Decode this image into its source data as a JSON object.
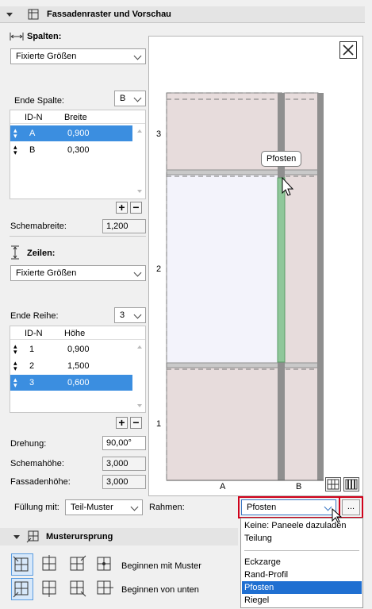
{
  "header": {
    "title": "Fassadenraster und Vorschau"
  },
  "columns": {
    "section_label": "Spalten:",
    "mode": "Fixierte Größen",
    "end_label": "Ende Spalte:",
    "end_value": "B",
    "table": {
      "col_id": "ID-N",
      "col_value": "Breite",
      "rows": [
        {
          "id": "A",
          "value": "0,900",
          "selected": true
        },
        {
          "id": "B",
          "value": "0,300",
          "selected": false
        }
      ]
    },
    "schema_label": "Schemabreite:",
    "schema_value": "1,200"
  },
  "rows": {
    "section_label": "Zeilen:",
    "mode": "Fixierte Größen",
    "end_label": "Ende Reihe:",
    "end_value": "3",
    "table": {
      "col_id": "ID-N",
      "col_value": "Höhe",
      "rows": [
        {
          "id": "1",
          "value": "0,900",
          "selected": false
        },
        {
          "id": "2",
          "value": "1,500",
          "selected": false
        },
        {
          "id": "3",
          "value": "0,600",
          "selected": true
        }
      ]
    }
  },
  "rotation": {
    "label": "Drehung:",
    "value": "90,00°"
  },
  "schema_height": {
    "label": "Schemahöhe:",
    "value": "3,000"
  },
  "facade_height": {
    "label": "Fassadenhöhe:",
    "value": "3,000"
  },
  "fill": {
    "label": "Füllung mit:",
    "value": "Teil-Muster"
  },
  "frame": {
    "label": "Rahmen:",
    "value": "Pfosten",
    "more_button": "...",
    "options": [
      {
        "label": "Keine: Paneele dazuladen",
        "selected": false
      },
      {
        "label": "Teilung",
        "selected": false
      },
      {
        "label": "Eckzarge",
        "selected": false
      },
      {
        "label": "Rand-Profil",
        "selected": false
      },
      {
        "label": "Pfosten",
        "selected": true
      },
      {
        "label": "Riegel",
        "selected": false
      }
    ]
  },
  "preview": {
    "row_labels": [
      "3",
      "2",
      "1"
    ],
    "col_labels": [
      "A",
      "B"
    ],
    "tooltip": "Pfosten"
  },
  "pattern_origin": {
    "title": "Musterursprung",
    "option1": "Beginnen mit Muster",
    "option2": "Beginnen von unten"
  },
  "colors": {
    "panel_fill": "#e7dcdc",
    "glass_fill": "#f3f3fb",
    "mullion": "#8f8f8f",
    "highlight_mullion": "#8fc79a",
    "selection": "#3b8ee0",
    "dropdown_highlight": "#1f6fd1",
    "red_outline": "#d0021b"
  }
}
